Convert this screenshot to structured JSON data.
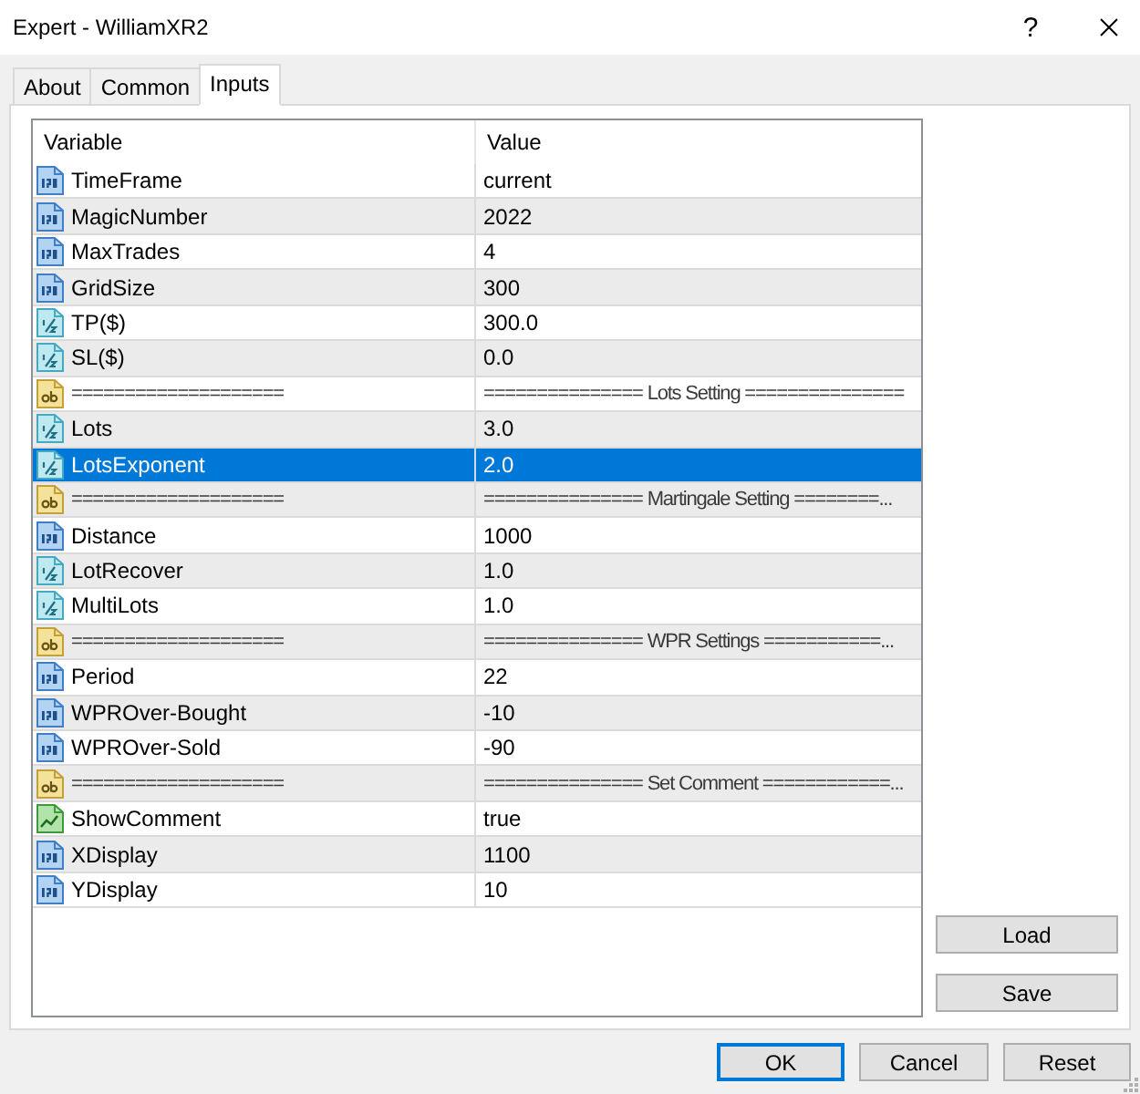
{
  "window": {
    "title": "Expert - WilliamXR2",
    "help_button": "?"
  },
  "tabs": [
    {
      "label": "About",
      "selected": false
    },
    {
      "label": "Common",
      "selected": false
    },
    {
      "label": "Inputs",
      "selected": true
    }
  ],
  "table": {
    "columns": [
      "Variable",
      "Value"
    ],
    "rows": [
      {
        "kind": "int",
        "variable": "TimeFrame",
        "value": "current",
        "selected": false
      },
      {
        "kind": "int",
        "variable": "MagicNumber",
        "value": "2022",
        "selected": false
      },
      {
        "kind": "int",
        "variable": "MaxTrades",
        "value": "4",
        "selected": false
      },
      {
        "kind": "int",
        "variable": "GridSize",
        "value": "300",
        "selected": false
      },
      {
        "kind": "double",
        "variable": "TP($)",
        "value": "300.0",
        "selected": false
      },
      {
        "kind": "double",
        "variable": "SL($)",
        "value": "0.0",
        "selected": false
      },
      {
        "kind": "string",
        "variable": "====================",
        "value": "=============== Lots Setting ===============",
        "selected": false
      },
      {
        "kind": "double",
        "variable": "Lots",
        "value": "3.0",
        "selected": false
      },
      {
        "kind": "double",
        "variable": "LotsExponent",
        "value": "2.0",
        "selected": true
      },
      {
        "kind": "string",
        "variable": "====================",
        "value": "=============== Martingale Setting ========...",
        "selected": false
      },
      {
        "kind": "int",
        "variable": "Distance",
        "value": "1000",
        "selected": false
      },
      {
        "kind": "double",
        "variable": "LotRecover",
        "value": "1.0",
        "selected": false
      },
      {
        "kind": "double",
        "variable": "MultiLots",
        "value": "1.0",
        "selected": false
      },
      {
        "kind": "string",
        "variable": "====================",
        "value": "=============== WPR Settings ===========...",
        "selected": false
      },
      {
        "kind": "int",
        "variable": "Period",
        "value": "22",
        "selected": false
      },
      {
        "kind": "int",
        "variable": "WPROver-Bought",
        "value": "-10",
        "selected": false
      },
      {
        "kind": "int",
        "variable": "WPROver-Sold",
        "value": "-90",
        "selected": false
      },
      {
        "kind": "string",
        "variable": "====================",
        "value": "=============== Set Comment ============...",
        "selected": false
      },
      {
        "kind": "bool",
        "variable": "ShowComment",
        "value": "true",
        "selected": false
      },
      {
        "kind": "int",
        "variable": "XDisplay",
        "value": "1100",
        "selected": false
      },
      {
        "kind": "int",
        "variable": "YDisplay",
        "value": "10",
        "selected": false
      }
    ]
  },
  "side_buttons": [
    "Load",
    "Save"
  ],
  "buttons": [
    {
      "label": "OK",
      "default": true
    },
    {
      "label": "Cancel",
      "default": false
    },
    {
      "label": "Reset",
      "default": false
    }
  ]
}
